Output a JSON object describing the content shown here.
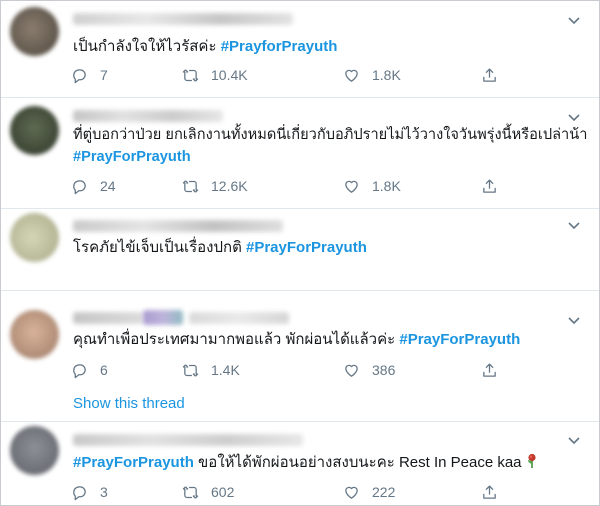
{
  "tweets": [
    {
      "text_parts": [
        "เป็นกำลังใจให้ไวรัสค่ะ ",
        "#PrayforPrayuth"
      ],
      "reply_count": "7",
      "retweet_count": "10.4K",
      "like_count": "1.8K"
    },
    {
      "text_line1": "ที่ตู่บอกว่าป่วย ยกเลิกงานทั้งหมดนี่เกี่ยวกับอภิปรายไม่ไว้วางใจวันพรุ่งนี้หรือเปล่าน้า",
      "hashtag": "#PrayForPrayuth",
      "reply_count": "24",
      "retweet_count": "12.6K",
      "like_count": "1.8K"
    },
    {
      "text_parts": [
        "โรคภัยไข้เจ็บเป็นเรื่องปกติ ",
        "#PrayForPrayuth"
      ]
    },
    {
      "text_parts": [
        "คุณทำเพื่อประเทศมามากพอแล้ว พักผ่อนได้แล้วค่ะ ",
        "#PrayForPrayuth"
      ],
      "reply_count": "6",
      "retweet_count": "1.4K",
      "like_count": "386",
      "show_thread": "Show this thread"
    },
    {
      "text_parts": [
        "#PrayForPrayuth",
        " ขอให้ได้พักผ่อนอย่างสงบนะคะ Rest In Peace kaa"
      ],
      "emoji": "wilted-rose",
      "reply_count": "3",
      "retweet_count": "602",
      "like_count": "222"
    }
  ],
  "colors": {
    "hashtag": "#1b95e0",
    "text": "#14171a",
    "muted": "#657786",
    "divider": "#e1e8ed"
  },
  "icons": [
    "reply-icon",
    "retweet-icon",
    "like-icon",
    "share-icon",
    "caret-down-icon"
  ]
}
